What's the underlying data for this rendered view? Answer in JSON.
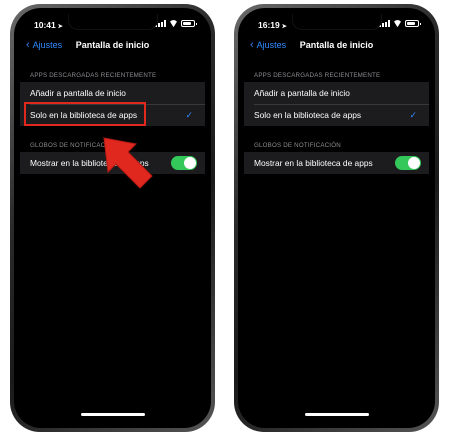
{
  "screens": [
    {
      "time": "10:41",
      "back_label": "Ajustes",
      "title": "Pantalla de inicio",
      "section1_header": "APPS DESCARGADAS RECIENTEMENTE",
      "option1": "Añadir a pantalla de inicio",
      "option2": "Solo en la biblioteca de apps",
      "section2_header": "GLOBOS DE NOTIFICACIÓN",
      "toggle_label": "Mostrar en la biblioteca de apps",
      "selected_option": "option2",
      "toggle_on": true
    },
    {
      "time": "16:19",
      "back_label": "Ajustes",
      "title": "Pantalla de inicio",
      "section1_header": "APPS DESCARGADAS RECIENTEMENTE",
      "option1": "Añadir a pantalla de inicio",
      "option2": "Solo en la biblioteca de apps",
      "section2_header": "GLOBOS DE NOTIFICACIÓN",
      "toggle_label": "Mostrar en la biblioteca de apps",
      "selected_option": "option2",
      "toggle_on": true
    }
  ],
  "colors": {
    "accent": "#2f8bff",
    "toggle_on": "#34c759",
    "highlight": "#e0281f",
    "cell_bg": "#1c1c1e",
    "section_text": "#8d8d93"
  },
  "icons": [
    "chevron-left-icon",
    "checkmark-icon",
    "signal-icon",
    "wifi-icon",
    "battery-icon",
    "location-arrow-icon",
    "red-pointer-arrow"
  ]
}
